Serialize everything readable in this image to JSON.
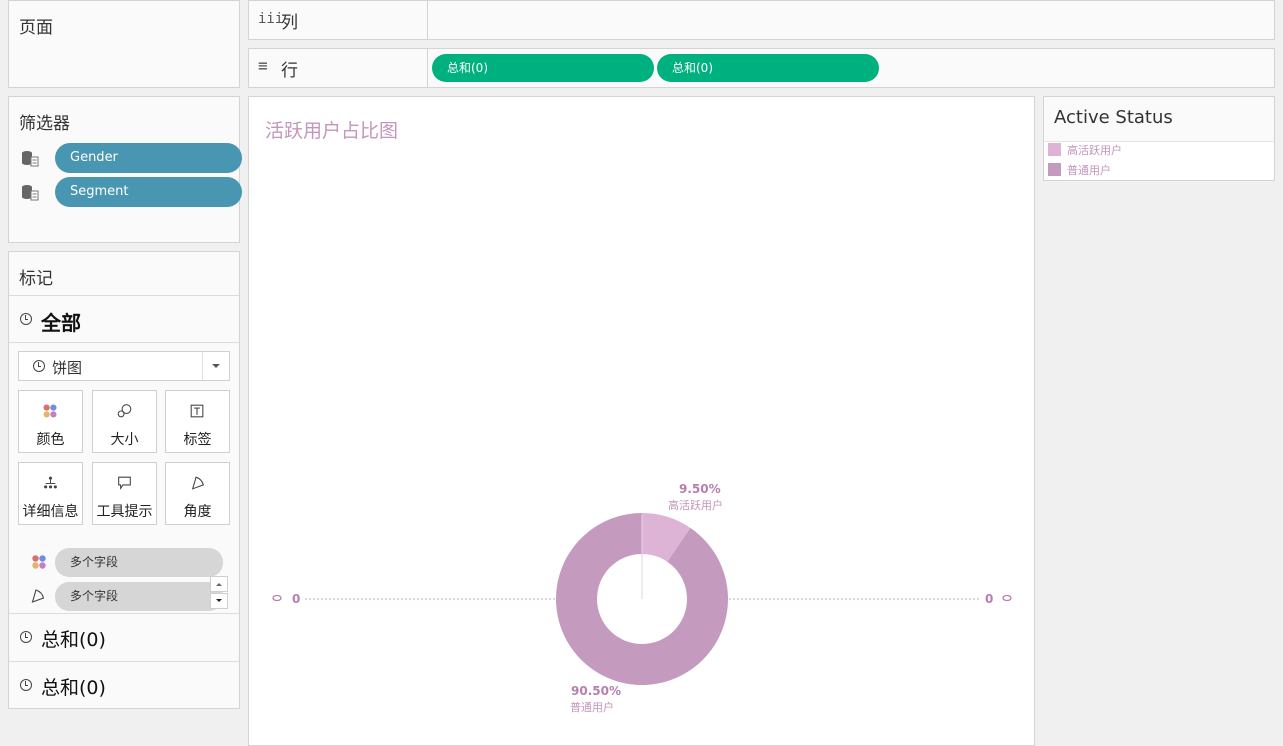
{
  "pages_panel": {
    "title": "页面"
  },
  "columns_shelf": {
    "icon": "iii",
    "label": "列"
  },
  "rows_shelf": {
    "icon": "≡",
    "label": "行",
    "pills": [
      "总和(0)",
      "总和(0)"
    ]
  },
  "filters_panel": {
    "title": "筛选器",
    "items": [
      "Gender",
      "Segment"
    ]
  },
  "marks_panel": {
    "title": "标记",
    "all_label": "全部",
    "mark_type": "饼图",
    "buttons": [
      "颜色",
      "大小",
      "标签",
      "详细信息",
      "工具提示",
      "角度"
    ],
    "field_pills": [
      "多个字段",
      "多个字段"
    ],
    "sections": [
      "总和(0)",
      "总和(0)"
    ]
  },
  "chart_data": {
    "type": "pie",
    "title": "活跃用户占比图",
    "categories": [
      "高活跃用户",
      "普通用户"
    ],
    "values": [
      9.5,
      90.5
    ],
    "value_labels": [
      "9.50%",
      "90.50%"
    ],
    "colors": [
      "#ddb4d5",
      "#c59abf"
    ],
    "hole": true,
    "axis_labels": {
      "left": "0",
      "right": "0"
    }
  },
  "legend": {
    "title": "Active Status",
    "items": [
      {
        "label": "高活跃用户",
        "color": "#ddb4d5"
      },
      {
        "label": "普通用户",
        "color": "#c59abf"
      }
    ]
  },
  "colors": {
    "green_pill": "#00b180",
    "blue_pill": "#4996b2",
    "accent_text": "#c496bd"
  }
}
